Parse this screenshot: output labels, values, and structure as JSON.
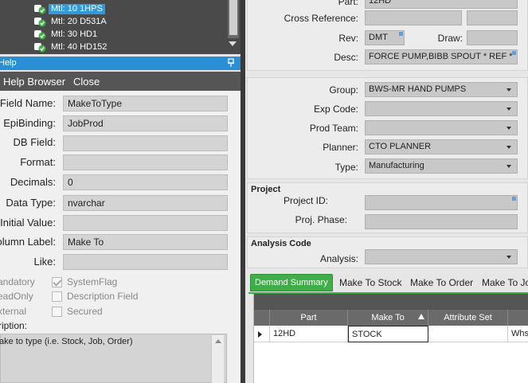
{
  "tree": {
    "items": [
      {
        "label": "Mtl: 10 1HPS",
        "selected": true
      },
      {
        "label": "Mtl: 20 D531A",
        "selected": false
      },
      {
        "label": "Mtl: 30 HD1",
        "selected": false
      },
      {
        "label": "Mtl: 40 HD152",
        "selected": false
      }
    ]
  },
  "help": {
    "title": "Help",
    "toolbar": {
      "browser": "Help Browser",
      "close": "Close"
    },
    "fields": {
      "field_name": {
        "label": "Field Name:",
        "value": "MakeToType"
      },
      "epi_binding": {
        "label": "EpiBinding:",
        "value": "JobProd"
      },
      "db_field": {
        "label": "DB Field:",
        "value": ""
      },
      "format": {
        "label": "Format:",
        "value": ""
      },
      "decimals": {
        "label": "Decimals:",
        "value": "0"
      },
      "data_type": {
        "label": "Data Type:",
        "value": "nvarchar"
      },
      "initial_value": {
        "label": "Initial Value:",
        "value": ""
      },
      "column_label": {
        "label": "olumn Label:",
        "value": "Make To"
      },
      "like": {
        "label": "Like:",
        "value": ""
      }
    },
    "checks": {
      "mandatory": {
        "side": "andatory",
        "label": "SystemFlag",
        "checked": true
      },
      "readonly": {
        "side": "eadOnly",
        "label": "Description Field",
        "checked": false
      },
      "external": {
        "side": "xternal",
        "label": "Secured",
        "checked": false
      }
    },
    "description_label": "ription:",
    "description": "ake to type (i.e. Stock, Job, Order)"
  },
  "part_form": {
    "part": {
      "label": "Part:",
      "value": "12HD"
    },
    "cross_reference": {
      "label": "Cross Reference:",
      "value": ""
    },
    "rev": {
      "label": "Rev:",
      "value": "DMT"
    },
    "draw": {
      "label": "Draw:",
      "value": ""
    },
    "desc": {
      "label": "Desc:",
      "value": "FORCE PUMP,BIBB SPOUT  * REF  *"
    }
  },
  "group_form": {
    "group": {
      "label": "Group:",
      "value": "BWS-MR HAND PUMPS"
    },
    "exp_code": {
      "label": "Exp Code:",
      "value": ""
    },
    "prod_team": {
      "label": "Prod Team:",
      "value": ""
    },
    "planner": {
      "label": "Planner:",
      "value": "CTO PLANNER"
    },
    "type": {
      "label": "Type:",
      "value": "Manufacturing"
    }
  },
  "project": {
    "title": "Project",
    "project_id": {
      "label": "Project ID:",
      "value": ""
    },
    "proj_phase": {
      "label": "Proj. Phase:",
      "value": ""
    }
  },
  "analysis": {
    "title": "Analysis Code",
    "analysis": {
      "label": "Analysis:",
      "value": ""
    }
  },
  "tabs": [
    "Demand Summary",
    "Make To Stock",
    "Make To Order",
    "Make To Jo"
  ],
  "grid": {
    "columns": [
      "Part",
      "Make To",
      "Attribute Set"
    ],
    "rows": [
      {
        "part": "12HD",
        "make_to": "STOCK",
        "attribute_set": "",
        "extra": "Whs"
      }
    ]
  },
  "colors": {
    "selection": "#3399dd",
    "help_header": "#2b8fd6",
    "active_tab": "#3fae49"
  }
}
